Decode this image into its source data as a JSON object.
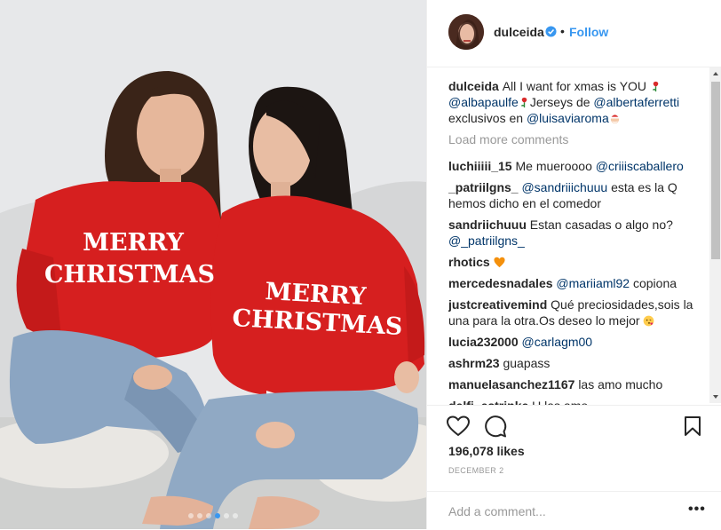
{
  "post": {
    "username": "dulceida",
    "follow_label": "Follow",
    "separator": "•",
    "caption_user": "dulceida",
    "caption": [
      {
        "t": "text",
        "v": "All I want for xmas is YOU "
      },
      {
        "t": "emoji",
        "v": "rose"
      },
      {
        "t": "mention",
        "v": "@albapaulfe"
      },
      {
        "t": "emoji",
        "v": "rose"
      },
      {
        "t": "text",
        "v": "Jerseys de "
      },
      {
        "t": "mention",
        "v": "@albertaferretti"
      },
      {
        "t": "text",
        "v": " exclusivos en "
      },
      {
        "t": "mention",
        "v": "@luisaviaroma"
      },
      {
        "t": "emoji",
        "v": "santa"
      }
    ],
    "load_more": "Load more comments",
    "comments": [
      {
        "user": "luchiiiii_15",
        "parts": [
          {
            "t": "text",
            "v": "Me mueroooo "
          },
          {
            "t": "mention",
            "v": "@criiiscaballero"
          }
        ]
      },
      {
        "user": "_patriilgns_",
        "parts": [
          {
            "t": "mention",
            "v": "@sandriiichuuu"
          },
          {
            "t": "text",
            "v": " esta es la Q hemos dicho en el comedor"
          }
        ]
      },
      {
        "user": "sandriichuuu",
        "parts": [
          {
            "t": "text",
            "v": "Estan casadas o algo no? "
          },
          {
            "t": "mention",
            "v": "@_patriilgns_"
          }
        ]
      },
      {
        "user": "rhotics",
        "parts": [
          {
            "t": "emoji",
            "v": "orange-heart"
          }
        ]
      },
      {
        "user": "mercedesnadales",
        "parts": [
          {
            "t": "mention",
            "v": "@mariiaml92"
          },
          {
            "t": "text",
            "v": " copiona"
          }
        ]
      },
      {
        "user": "justcreativemind",
        "parts": [
          {
            "t": "text",
            "v": "Qué preciosidades,sois la una para la otra.Os deseo lo mejor "
          },
          {
            "t": "emoji",
            "v": "kiss-face"
          }
        ]
      },
      {
        "user": "lucia232000",
        "parts": [
          {
            "t": "mention",
            "v": "@carlagm00"
          }
        ]
      },
      {
        "user": "ashrm23",
        "parts": [
          {
            "t": "text",
            "v": "guapass"
          }
        ]
      },
      {
        "user": "manuelasanchez1167",
        "parts": [
          {
            "t": "text",
            "v": "las amo mucho"
          }
        ]
      },
      {
        "user": "delfi_estrinke",
        "parts": [
          {
            "t": "text",
            "v": "U las amo"
          }
        ]
      }
    ],
    "likes": "196,078 likes",
    "date": "DECEMBER 2",
    "add_comment_placeholder": "Add a comment...",
    "more_label": "•••",
    "photo_text": {
      "line1": "MERRY",
      "line2": "CHRISTMAS"
    },
    "carousel": {
      "count": 6,
      "active_index": 3
    },
    "colors": {
      "link": "#3897f0",
      "mention": "#003569",
      "sweater": "#d61f1f",
      "denim": "#8ba5c2"
    }
  }
}
